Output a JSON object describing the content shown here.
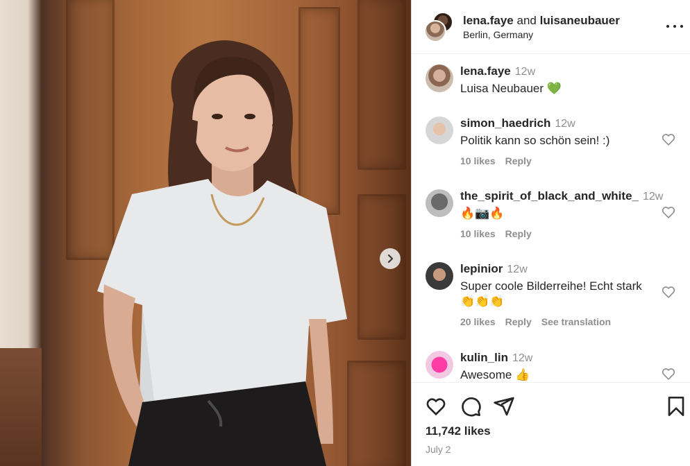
{
  "header": {
    "user1": "lena.faye",
    "joiner": "and",
    "user2": "luisaneubauer",
    "location": "Berlin, Germany"
  },
  "caption": {
    "user": "lena.faye",
    "time": "12w",
    "text": "Luisa Neubauer 💚"
  },
  "comments": [
    {
      "user": "simon_haedrich",
      "time": "12w",
      "text": "Politik kann so schön sein! :)",
      "likes": "10 likes",
      "reply": "Reply",
      "translation": ""
    },
    {
      "user": "the_spirit_of_black_and_white_",
      "time": "12w",
      "text": "🔥📷🔥",
      "likes": "10 likes",
      "reply": "Reply",
      "translation": ""
    },
    {
      "user": "lepinior",
      "time": "12w",
      "text": "Super coole Bilderreihe! Echt stark 👏👏👏",
      "likes": "20 likes",
      "reply": "Reply",
      "translation": "See translation"
    },
    {
      "user": "kulin_lin",
      "time": "12w",
      "text": "Awesome 👍",
      "likes": "",
      "reply": "",
      "translation": ""
    }
  ],
  "footer": {
    "likes": "11,742 likes",
    "date": "July 2"
  },
  "icons": {
    "heart": "heart-icon",
    "comment": "comment-icon",
    "share": "share-icon",
    "bookmark": "bookmark-icon",
    "more": "more-icon",
    "next": "chevron-right-icon"
  },
  "colors": {
    "text": "#262626",
    "muted": "#8e8e8e",
    "border": "#dbdbdb"
  }
}
